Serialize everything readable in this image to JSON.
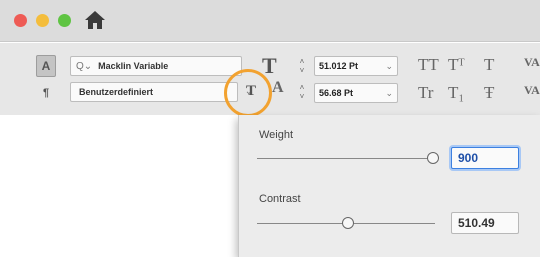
{
  "window": {
    "icons": {
      "home": "home-icon"
    }
  },
  "character": {
    "mode_char_label": "A",
    "mode_para_label": "¶",
    "font_search_icon": "Q⌄",
    "font_name": "Macklin Variable",
    "font_style": "Benutzerdefiniert",
    "font_size": "51.012 Pt",
    "leading": "56.68 Pt",
    "size_icon_glyph": "T",
    "leading_icon_glyph": "A",
    "var_button_glyph": "T",
    "case_buttons": [
      "TT",
      "Tᵀ",
      "T",
      "Tr",
      "T₁",
      "Ŧ"
    ],
    "partial_label_top": "VA",
    "partial_label_bottom": "VA",
    "highlight_color": "#f2a230"
  },
  "variable_font_popover": {
    "weight_label": "Weight",
    "weight_value": "900",
    "weight_fraction": 0.99,
    "contrast_label": "Contrast",
    "contrast_value": "510.49",
    "contrast_fraction": 0.51
  }
}
